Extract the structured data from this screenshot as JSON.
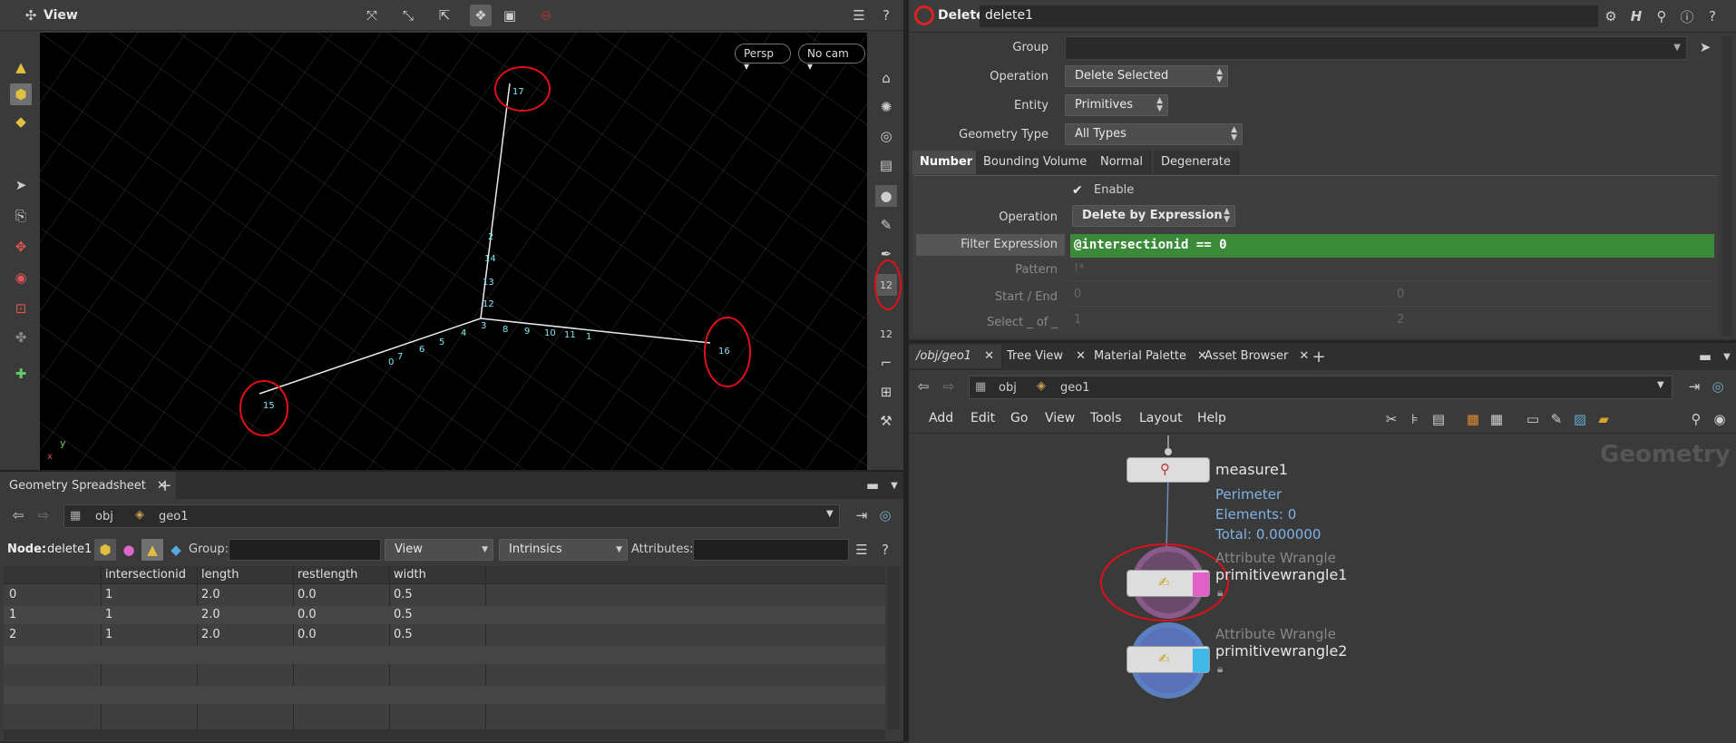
{
  "viewport": {
    "title": "View",
    "persp": "Persp",
    "camera": "No cam",
    "point_labels": [
      "17",
      "2",
      "14",
      "13",
      "12",
      "3",
      "8",
      "9",
      "10",
      "11",
      "1",
      "16",
      "4",
      "5",
      "6",
      "7",
      "0",
      "15"
    ],
    "axis_y": "y"
  },
  "spreadsheet": {
    "tab": "Geometry Spreadsheet",
    "path": [
      "obj",
      "geo1"
    ],
    "node_label": "Node:",
    "node_name": "delete1",
    "group_label": "Group:",
    "view": "View",
    "intrinsics": "Intrinsics",
    "attributes_label": "Attributes:",
    "columns": [
      "",
      "intersectionid",
      "length",
      "restlength",
      "width"
    ],
    "rows": [
      [
        "0",
        "1",
        "2.0",
        "0.0",
        "0.5"
      ],
      [
        "1",
        "1",
        "2.0",
        "0.0",
        "0.5"
      ],
      [
        "2",
        "1",
        "2.0",
        "0.0",
        "0.5"
      ]
    ]
  },
  "params": {
    "node_type": "Delete",
    "node_name": "delete1",
    "group_label": "Group",
    "operation_label": "Operation",
    "operation_value": "Delete Selected",
    "entity_label": "Entity",
    "entity_value": "Primitives",
    "geotype_label": "Geometry Type",
    "geotype_value": "All Types",
    "tabs": [
      "Number",
      "Bounding Volume",
      "Normal",
      "Degenerate"
    ],
    "enable_label": "Enable",
    "op2_label": "Operation",
    "op2_value": "Delete by Expression",
    "filter_label": "Filter Expression",
    "filter_value": "@intersectionid == 0",
    "pattern_label": "Pattern",
    "pattern_value": "!*",
    "startend_label": "Start / End",
    "start_value": "0",
    "end_value": "0",
    "select_label": "Select _ of _",
    "select_a": "1",
    "select_b": "2"
  },
  "network": {
    "tabs": [
      "/obj/geo1",
      "Tree View",
      "Material Palette",
      "Asset Browser"
    ],
    "path": [
      "obj",
      "geo1"
    ],
    "menu": [
      "Add",
      "Edit",
      "Go",
      "View",
      "Tools",
      "Layout",
      "Help"
    ],
    "context": "Geometry",
    "nodes": {
      "measure": {
        "name": "measure1",
        "info1": "Perimeter",
        "info2": "Elements: 0",
        "info3": "Total: 0.000000"
      },
      "wrangle1": {
        "type": "Attribute Wrangle",
        "name": "primitivewrangle1"
      },
      "wrangle2": {
        "type": "Attribute Wrangle",
        "name": "primitivewrangle2"
      }
    }
  },
  "colors": {
    "accent_green": "#3a8a3a",
    "annotation_red": "#e0101a",
    "info_blue": "#7fb2e5"
  }
}
